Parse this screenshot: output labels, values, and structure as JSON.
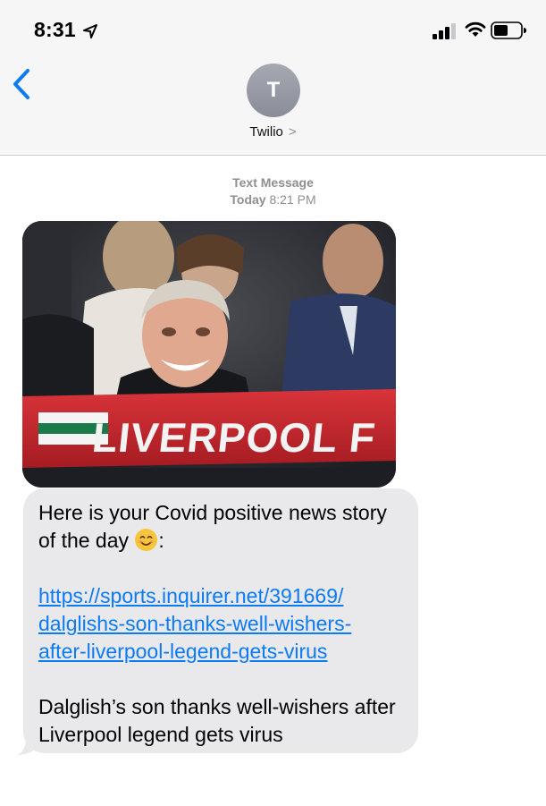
{
  "status_bar": {
    "time": "8:31",
    "icons": [
      "location-arrow-icon",
      "cellular-signal-icon",
      "wifi-icon",
      "battery-icon"
    ]
  },
  "header": {
    "back_icon": "chevron-left-icon",
    "avatar_initial": "T",
    "contact_name": "Twilio",
    "contact_chevron": ">"
  },
  "conversation": {
    "service_label": "Text Message",
    "day_label": "Today",
    "time_label": "8:21 PM",
    "image": {
      "scarf_text": "LIVERPOOL F"
    },
    "message": {
      "intro_line": "Here is your Covid positive news story of the day",
      "intro_suffix": ":",
      "emoji": "smiling-face-emoji",
      "link_text": "https://sports.inquirer.net/391669/dalglishs-son-thanks-well-wishers-after-liverpool-legend-gets-virus",
      "link_lines": [
        "https://sports.inquirer.net/391669/",
        "dalglishs-son-thanks-well-wishers-",
        "after-liverpool-legend-gets-virus"
      ],
      "preview_title": "Dalglish’s son thanks well-wishers after Liverpool legend gets virus"
    }
  },
  "colors": {
    "accent": "#0b7bf5",
    "header_bg": "#f6f6f7",
    "bubble_bg": "#e9e9eb",
    "meta_text": "#8e8e93",
    "scarf_red": "#c8242b"
  }
}
